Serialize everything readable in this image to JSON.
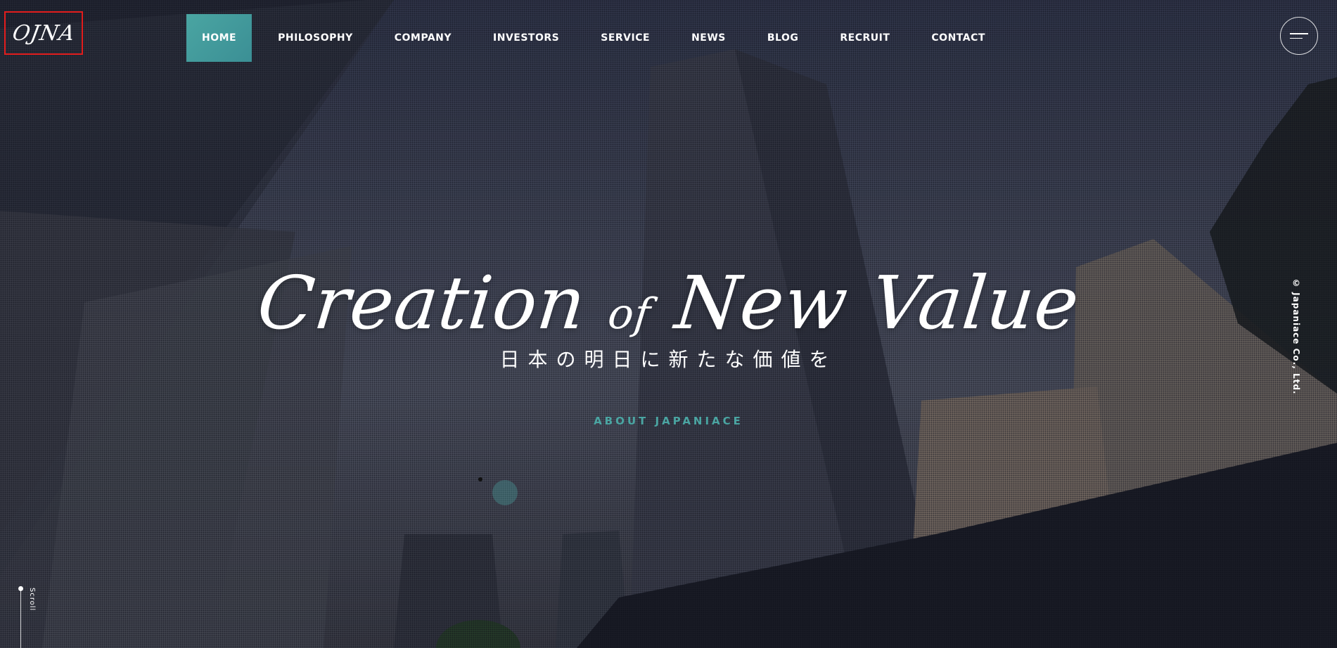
{
  "brand": {
    "logo_text": "OJNA"
  },
  "nav": {
    "items": [
      {
        "label": "HOME",
        "active": true
      },
      {
        "label": "PHILOSOPHY",
        "active": false
      },
      {
        "label": "COMPANY",
        "active": false
      },
      {
        "label": "INVESTORS",
        "active": false
      },
      {
        "label": "SERVICE",
        "active": false
      },
      {
        "label": "NEWS",
        "active": false
      },
      {
        "label": "BLOG",
        "active": false
      },
      {
        "label": "RECRUIT",
        "active": false
      },
      {
        "label": "CONTACT",
        "active": false
      }
    ]
  },
  "menu_button": {
    "icon": "hamburger-menu-icon"
  },
  "hero": {
    "headline_part1": "Creation",
    "headline_part2": "of",
    "headline_part3": "New Value",
    "subheading": "日本の明日に新たな価値を",
    "about_link": "ABOUT JAPANIACE"
  },
  "copyright": "© Japaniace Co., Ltd.",
  "scroll": {
    "label": "Scroll"
  },
  "colors": {
    "accent": "#4aa5a2",
    "logo_highlight_border": "#e21c1c",
    "text": "#ffffff"
  }
}
